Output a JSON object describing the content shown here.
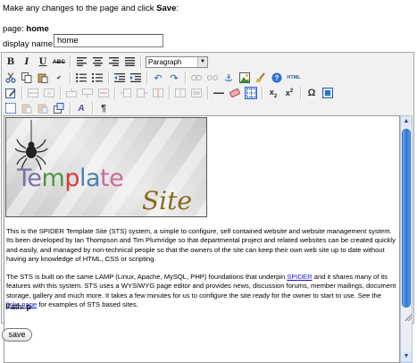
{
  "intro": {
    "text": "Make any changes to the page and click ",
    "bold": "Save",
    "end": ":"
  },
  "page": {
    "label": "page: ",
    "name": "home"
  },
  "display_name": {
    "label": "display name:",
    "value": "home"
  },
  "toolbar": {
    "format_select": "Paragraph",
    "html_label": "HTML",
    "bold_label": "B",
    "italic_label": "I",
    "underline_label": "U",
    "strike_label": "ABC"
  },
  "banner": {
    "text1_a": "Te",
    "text1_b": "m",
    "text1_c": "p",
    "text1_d": "la",
    "text1_e": "te",
    "text2": "Site",
    "colors": {
      "te": "#7b6fa6",
      "m": "#4f9a3e",
      "p": "#d43c3c",
      "la": "#4a7fb3",
      "te2": "#c86d9a",
      "site": "#8a6a1d"
    }
  },
  "content": {
    "para1": "This is the SPIDER Template Site (STS) system, a simple to configure, self contained website and website management system.  Its been developed by Ian Thompson and Tim Plumridge so that departmental project and related websites can be created quickly and easily, and managed by non-technical people so that the owners of the site can keep their own web site up to date without having any knowledge of HTML, CSS or scripting.",
    "para2_a": "The STS is built on the same LAMP (Linux, Apache, MySQL, PHP) foundations that underpin ",
    "para2_link": "SPIDER",
    "para2_b": " and it shares many of its features with this system.  STS uses a WYSIWYG page editor and provides news, discussion forums, member mailings, document storage, gallery and much more. It takes a few minutes for us to configure the site ready for the owner to start to use.  See the ",
    "para2_link2": "links page",
    "para2_c": " for examples of STS based sites."
  },
  "path": {
    "label": "Path: ",
    "value": "p"
  },
  "save_label": "save"
}
